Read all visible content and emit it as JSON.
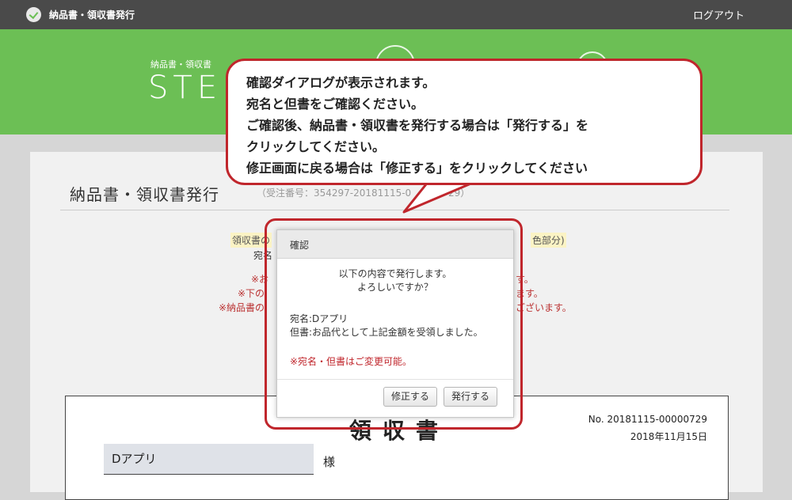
{
  "header": {
    "app_title": "納品書・領収書発行",
    "logout_label": "ログアウト"
  },
  "hero": {
    "subtitle": "納品書・領収書",
    "step_label": "STE"
  },
  "card": {
    "page_title": "納品書・領収書発行",
    "order_no": "（受注番号：354297-20181115-0",
    "order_no_tail": "29）",
    "bg_left": {
      "tag": "領収書の",
      "line1": "宛名",
      "note1": "※お",
      "note2": "※下の",
      "note3": "※納品書の"
    },
    "bg_right": {
      "tag": "色部分)",
      "note1": "す。",
      "note2": "ます。",
      "note3": "ございます。"
    }
  },
  "receipt": {
    "title": "領収書",
    "number": "No. 20181115-00000729",
    "date": "2018年11月15日",
    "addressee": "Dアプリ",
    "honorific": "様"
  },
  "dialog": {
    "title": "確認",
    "message_line1": "以下の内容で発行します。",
    "message_line2": "よろしいですか？",
    "addressee_line": "宛名:Dアプリ",
    "proviso_line": "但書:お品代として上記金額を受領しました。",
    "note": "※宛名・但書はご変更可能。",
    "edit_button": "修正する",
    "issue_button": "発行する"
  },
  "callout": {
    "lines": [
      "確認ダイアログが表示されます。",
      "宛名と但書をご確認ください。",
      "ご確認後、納品書・領収書を発行する場合は「発行する」を",
      "クリックしてください。",
      "修正画面に戻る場合は「修正する」をクリックしてください"
    ]
  },
  "colors": {
    "topbar": "#4a4a4a",
    "hero_green": "#6cbf55",
    "highlight_red": "#c0262c",
    "tag_yellow": "#fbf3c4"
  }
}
